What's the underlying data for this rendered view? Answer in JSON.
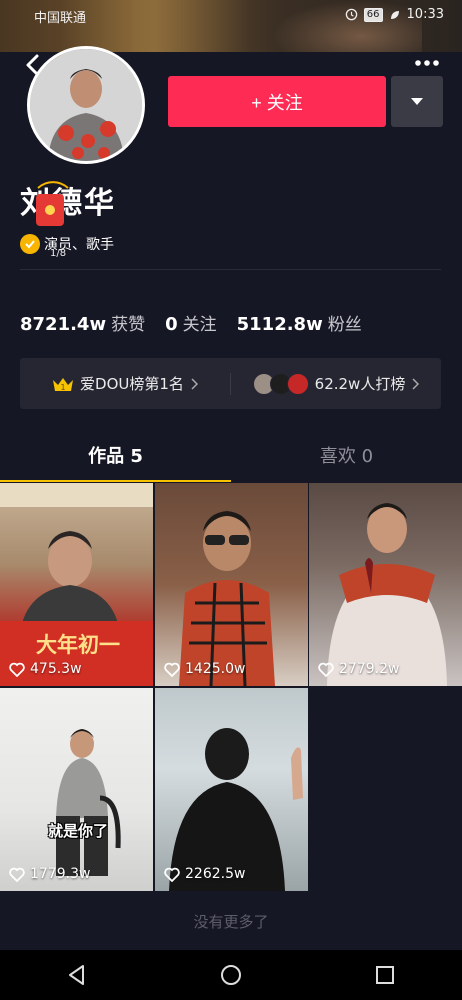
{
  "status_bar": {
    "carrier": "中国联通",
    "battery": "66",
    "time": "10:33"
  },
  "profile": {
    "name": "刘德华",
    "tags": "演员、歌手",
    "redpacket_count": "1/8",
    "follow_label": "+ 关注"
  },
  "stats": [
    {
      "value": "8721.4w",
      "label": "获赞"
    },
    {
      "value": "0",
      "label": "关注"
    },
    {
      "value": "5112.8w",
      "label": "粉丝"
    }
  ],
  "rank": {
    "left_text": "爱DOU榜第1名",
    "right_text": "62.2w人打榜"
  },
  "tabs": [
    {
      "label": "作品 5"
    },
    {
      "label": "喜欢 0"
    }
  ],
  "videos": [
    {
      "likes": "475.3w",
      "caption": "大年初一"
    },
    {
      "likes": "1425.0w"
    },
    {
      "likes": "2779.2w"
    },
    {
      "likes": "1779.3w",
      "caption": "就是你了"
    },
    {
      "likes": "2262.5w"
    }
  ],
  "footer": {
    "no_more": "没有更多了"
  },
  "colors": {
    "background": "#161724",
    "follow_button": "#fe2c55",
    "tab_underline": "#f7c300"
  }
}
